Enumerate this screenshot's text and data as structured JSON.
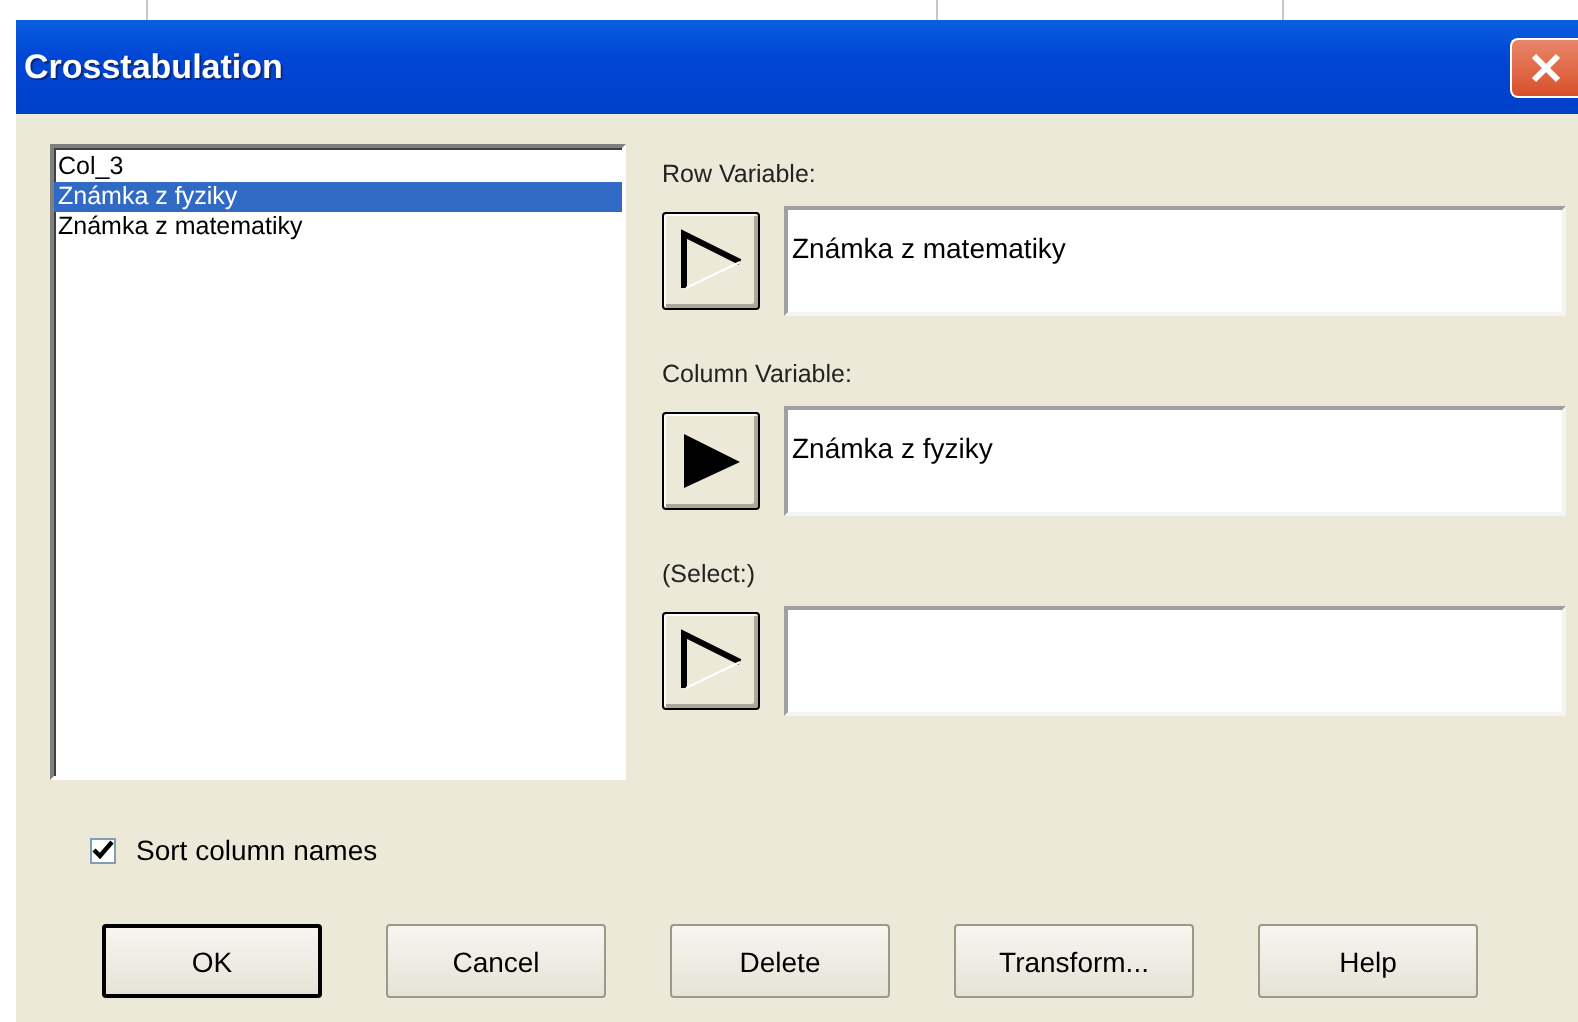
{
  "window": {
    "title": "Crosstabulation"
  },
  "columns_list": [
    {
      "label": "Col_3",
      "selected": false
    },
    {
      "label": "Známka z fyziky",
      "selected": true
    },
    {
      "label": "Známka z matematiky",
      "selected": false
    }
  ],
  "variables": [
    {
      "label": "Row Variable:",
      "value": "Známka z matematiky",
      "active": false
    },
    {
      "label": "Column Variable:",
      "value": "Známka z fyziky",
      "active": true
    },
    {
      "label": "(Select:)",
      "active": false
    }
  ],
  "sort_column_names": {
    "label": "Sort column names",
    "checked": true
  },
  "buttons": [
    {
      "label": "OK",
      "default": true
    },
    {
      "label": "Cancel",
      "default": false
    },
    {
      "label": "Delete",
      "default": false
    },
    {
      "label": "Transform...",
      "default": false
    },
    {
      "label": "Help",
      "default": false
    }
  ]
}
